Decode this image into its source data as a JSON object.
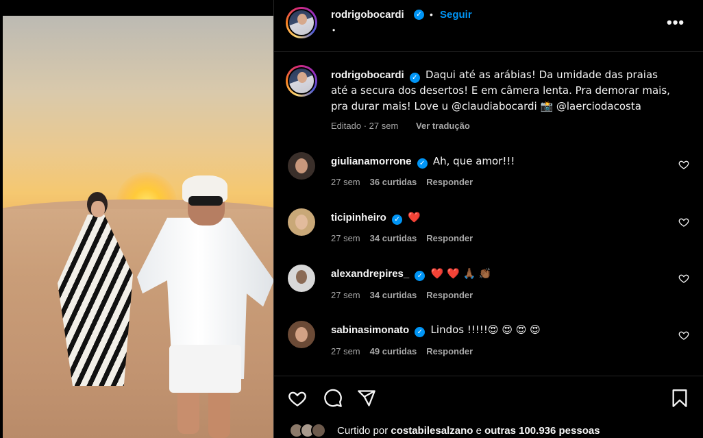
{
  "post": {
    "username": "rodrigobocardi",
    "verified_mark": "✓",
    "separator": "•",
    "follow_label": "Seguir",
    "sub_dot": "•",
    "more_label": "•••"
  },
  "caption": {
    "username": "rodrigobocardi",
    "text": "Daqui até as arábias! Da umidade das praias até a secura dos desertos! E em câmera lenta. Pra demorar mais, pra durar mais! Love u @claudiabocardi 📸 @laerciodacosta",
    "edited": "Editado · 27 sem",
    "translate": "Ver tradução"
  },
  "comments": [
    {
      "username": "giulianamorrone",
      "text": "Ah, que amor!!!",
      "age": "27 sem",
      "likes": "36 curtidas",
      "reply": "Responder",
      "avatar_color": "#3a2f2a"
    },
    {
      "username": "ticipinheiro",
      "text": "❤️",
      "age": "27 sem",
      "likes": "34 curtidas",
      "reply": "Responder",
      "avatar_color": "#c9a878"
    },
    {
      "username": "alexandrepires_",
      "text": "❤️ ❤️ 🙏🏾 👏🏾",
      "age": "27 sem",
      "likes": "34 curtidas",
      "reply": "Responder",
      "avatar_color": "#d8d8d8"
    },
    {
      "username": "sabinasimonato",
      "text": "Lindos !!!!!😍 😍 😍 😍",
      "age": "27 sem",
      "likes": "49 curtidas",
      "reply": "Responder",
      "avatar_color": "#6b4a36"
    }
  ],
  "icons": {
    "like": "heart-icon",
    "comment": "comment-icon",
    "share": "share-icon",
    "save": "bookmark-icon"
  },
  "likes_line": {
    "prefix": "Curtido por ",
    "user": "costabilesalzano",
    "middle": " e ",
    "others": "outras 100.936 pessoas"
  },
  "colors": {
    "accent": "#0095f6",
    "muted": "#a8a8a8",
    "heart_red": "#ff3040"
  }
}
